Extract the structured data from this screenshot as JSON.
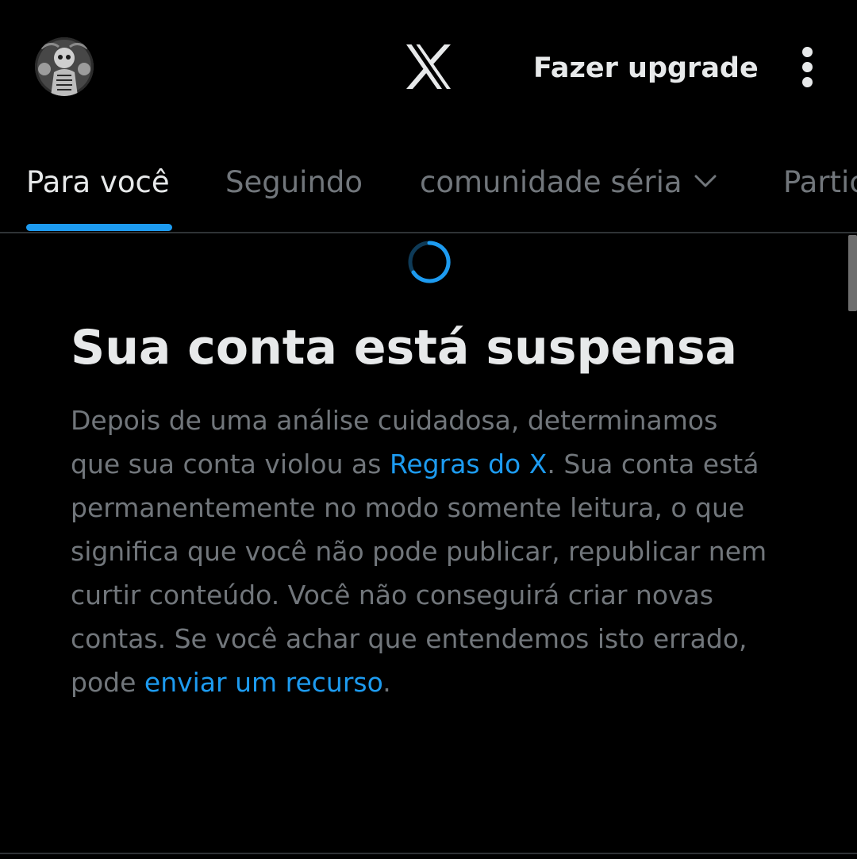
{
  "header": {
    "avatar_icon": "user-avatar",
    "logo_icon": "x-logo-icon",
    "upgrade_label": "Fazer upgrade",
    "more_icon": "more-vertical-icon"
  },
  "tabs": [
    {
      "label": "Para você",
      "active": true
    },
    {
      "label": "Seguindo",
      "active": false
    },
    {
      "label": "comunidade séria",
      "active": false,
      "icon": "chevron-down-icon"
    },
    {
      "label": "Partic",
      "active": false
    }
  ],
  "loading_icon": "spinner-icon",
  "suspension": {
    "title": "Sua conta está suspensa",
    "body_part1": "Depois de uma análise cuidadosa, determinamos que sua conta violou as ",
    "rules_link": "Regras do X",
    "body_part2": ". Sua conta está permanentemente no modo somente leitura, o que significa que você não pode publicar, republicar nem curtir conteúdo. Você não conseguirá criar novas contas. Se você achar que entendemos isto errado, pode ",
    "appeal_link": "enviar um recurso",
    "body_part3": "."
  },
  "colors": {
    "background": "#000000",
    "text_primary": "#e7e9ea",
    "text_secondary": "#71767b",
    "accent": "#1d9bf0",
    "divider": "#2f3336"
  }
}
